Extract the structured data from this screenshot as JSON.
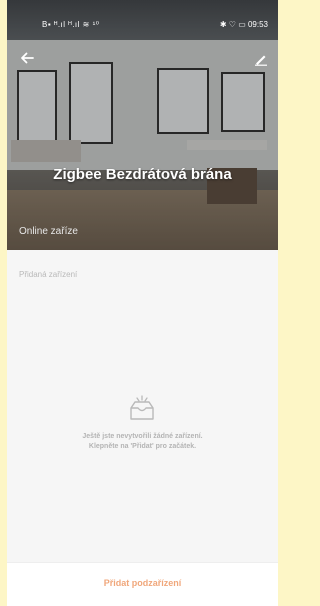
{
  "status_bar": {
    "left_text": "B▪ ᴴ.ıl ᴴ.ıl ≋ ¹⁰",
    "right_text": "✱ ♡ ▭ 09:53"
  },
  "header": {
    "back_icon": "arrow-left-icon",
    "edit_icon": "pencil-icon"
  },
  "hub": {
    "name": "Zigbee Bezdrátová brána",
    "online_label": "Online zaříze"
  },
  "devices": {
    "section_label": "Přidaná zařízení",
    "empty_icon": "empty-box-icon",
    "empty_line1": "Ještě jste nevytvořili žádné zařízení.",
    "empty_line2": "Klepněte na 'Přidat' pro začátek."
  },
  "footer": {
    "add_label": "Přidat podzařízení",
    "accent_color": "#f0a77b"
  }
}
